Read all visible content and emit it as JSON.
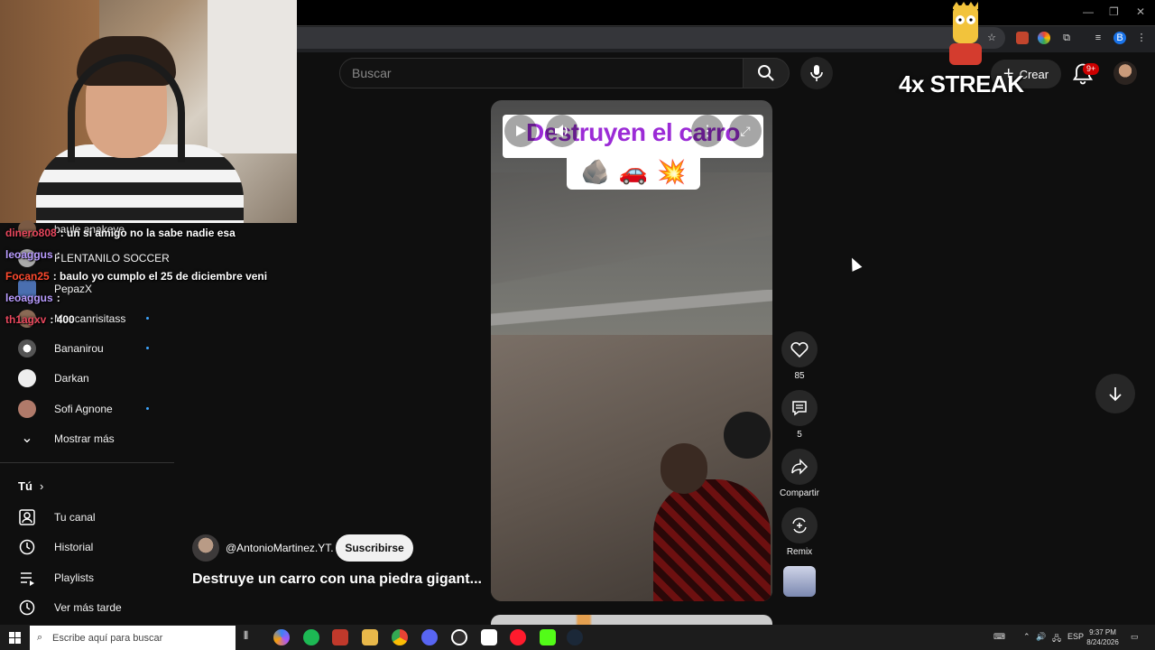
{
  "browser": {
    "window_controls": [
      "—",
      "❐",
      "✕"
    ],
    "profile_letter": "B"
  },
  "youtube": {
    "search": {
      "placeholder": "Buscar",
      "value": ""
    },
    "create_label": "Crear",
    "notif_badge": "9+"
  },
  "overlay": {
    "streak_text": "4x STREAK"
  },
  "chat": [
    {
      "user": "dinero808",
      "color": "#e8475d",
      "message": ": un si amigo no la sabe nadie esa"
    },
    {
      "user": "leoaggus",
      "color": "#b99cff",
      "message": ":"
    },
    {
      "user": "Focan25",
      "color": "#ff4a2e",
      "message": ": baulo yo cumplo el 25 de diciembre veni"
    },
    {
      "user": "leoaggus",
      "color": "#b99cff",
      "message": ":"
    },
    {
      "user": "th1agxv",
      "color": "#e8475d",
      "message": ": 400"
    }
  ],
  "sidebar": {
    "subscriptions": [
      {
        "label": "baule anakeye",
        "live": false
      },
      {
        "label": "FLENTANILO SOCCER",
        "live": false
      },
      {
        "label": "PepazX",
        "live": false
      },
      {
        "label": "Mascanrisitass",
        "live": true
      },
      {
        "label": "Bananirou",
        "live": true
      },
      {
        "label": "Darkan",
        "live": false
      },
      {
        "label": "Sofi Agnone",
        "live": true
      }
    ],
    "show_more": "Mostrar más",
    "you_header": "Tú",
    "you_items": [
      {
        "label": "Tu canal",
        "icon": "user-square-icon"
      },
      {
        "label": "Historial",
        "icon": "history-icon"
      },
      {
        "label": "Playlists",
        "icon": "playlist-icon"
      },
      {
        "label": "Ver más tarde",
        "icon": "clock-icon"
      }
    ]
  },
  "short": {
    "overlay_title": "Destruyen el carro",
    "overlay_emojis": [
      "🪨",
      "🚗",
      "💥"
    ],
    "channel": "@AntonioMartinez.YT.",
    "subscribe_label": "Suscribirse",
    "title": "Destruye un carro con una piedra gigant...",
    "likes": "85",
    "comments": "5",
    "share_label": "Compartir",
    "remix_label": "Remix"
  },
  "taskbar": {
    "search_placeholder": "Escribe aquí para buscar",
    "lang": "ESP",
    "time": "9:37 PM",
    "date": "8/24/2026"
  },
  "colors": {
    "accent_purple": "#9b2bd6",
    "background": "#0f0f0f",
    "live_dot": "#3ea6ff",
    "badge_red": "#cc0000"
  }
}
